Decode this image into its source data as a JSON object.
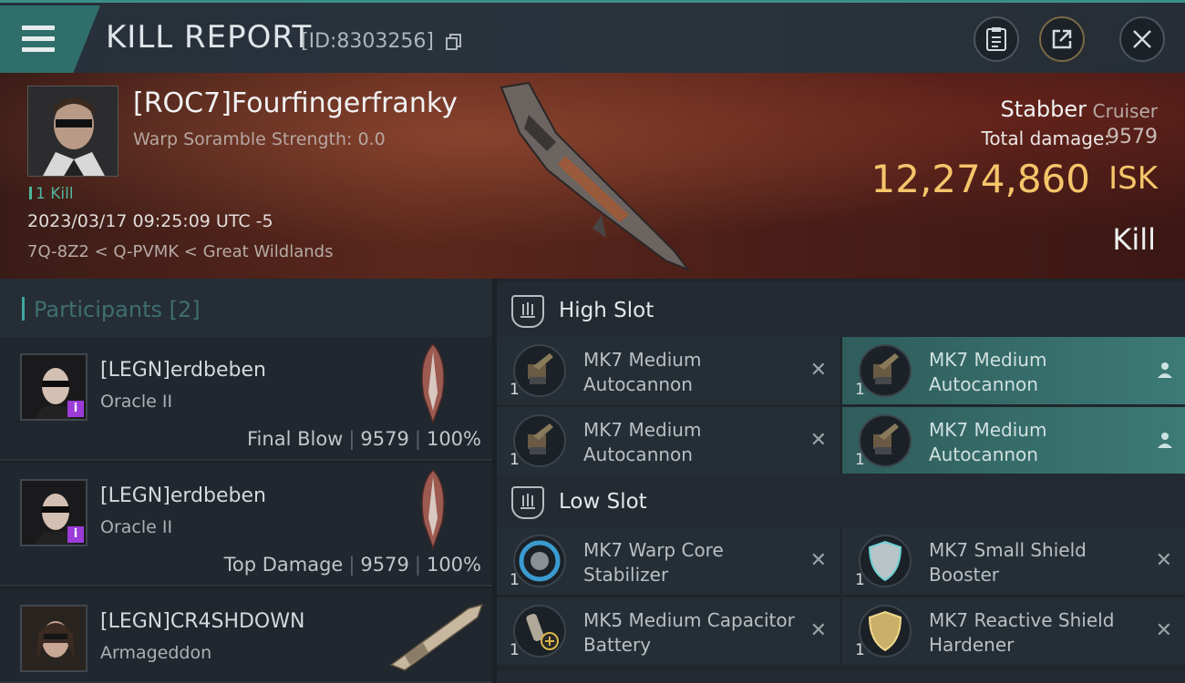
{
  "header": {
    "title": "KILL REPORT",
    "report_id": "[ID:8303256]"
  },
  "victim": {
    "name": "[ROC7]Fourfingerfranky",
    "scramble": "Warp Soramble Strength: 0.0",
    "kill_count": "1 Kill",
    "datetime": "2023/03/17 09:25:09 UTC -5",
    "location": "7Q-8Z2 < Q-PVMK < Great Wildlands",
    "ship_name": "Stabber",
    "ship_class": "Cruiser",
    "total_damage_label": "Total damage:",
    "total_damage": "9579",
    "isk_value": "12,274,860",
    "isk_label": "ISK",
    "outcome": "Kill"
  },
  "participants": {
    "title": "Participants",
    "count": "[2]",
    "items": [
      {
        "name": "[LEGN]erdbeben",
        "ship": "Oracle II",
        "role": "Final Blow",
        "damage": "9579",
        "percent": "100%",
        "badge": "i"
      },
      {
        "name": "[LEGN]erdbeben",
        "ship": "Oracle II",
        "role": "Top Damage",
        "damage": "9579",
        "percent": "100%",
        "badge": "i"
      },
      {
        "name": "[LEGN]CR4SHDOWN",
        "ship": "Armageddon"
      }
    ]
  },
  "slots": {
    "high": {
      "title": "High Slot",
      "modules": [
        {
          "name": "MK7 Medium Autocannon",
          "qty": "1",
          "state": "destroyed"
        },
        {
          "name": "MK7 Medium Autocannon",
          "qty": "1",
          "state": "dropped"
        },
        {
          "name": "MK7 Medium Autocannon",
          "qty": "1",
          "state": "destroyed"
        },
        {
          "name": "MK7 Medium Autocannon",
          "qty": "1",
          "state": "dropped"
        }
      ]
    },
    "low": {
      "title": "Low Slot",
      "modules": [
        {
          "name": "MK7 Warp Core Stabilizer",
          "qty": "1",
          "state": "destroyed"
        },
        {
          "name": "MK7 Small Shield Booster",
          "qty": "1",
          "state": "destroyed"
        },
        {
          "name": "MK5 Medium Capacitor Battery",
          "qty": "1",
          "state": "destroyed"
        },
        {
          "name": "MK7 Reactive Shield Hardener",
          "qty": "1",
          "state": "destroyed"
        }
      ]
    }
  },
  "colors": {
    "accent": "#3fa7a0",
    "isk": "#f5c56a",
    "fitted": "#3c7a76",
    "badge": "#9b3bd8"
  },
  "icons": [
    "menu-icon",
    "copy-icon",
    "clipboard-icon",
    "export-icon",
    "close-icon",
    "slot-icon",
    "user-icon",
    "x-icon"
  ]
}
